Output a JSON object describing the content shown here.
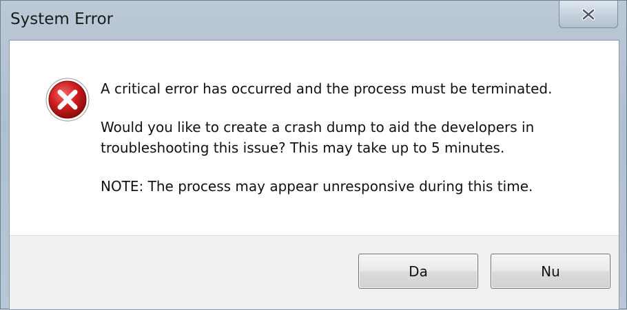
{
  "window": {
    "title": "System Error",
    "close_icon": "close-icon"
  },
  "dialog": {
    "icon": "error-icon",
    "messages": [
      {
        "lines": [
          "A critical error has occurred and the process must be terminated."
        ]
      },
      {
        "lines": [
          "Would you like to create a crash dump to aid the developers in",
          "troubleshooting this issue? This may take up to 5 minutes."
        ]
      },
      {
        "lines": [
          "NOTE: The process may appear unresponsive during this time."
        ]
      }
    ]
  },
  "buttons": {
    "yes_label": "Da",
    "no_label": "Nu"
  },
  "colors": {
    "error_red": "#c81818",
    "titlebar": "#b4c4d4"
  }
}
